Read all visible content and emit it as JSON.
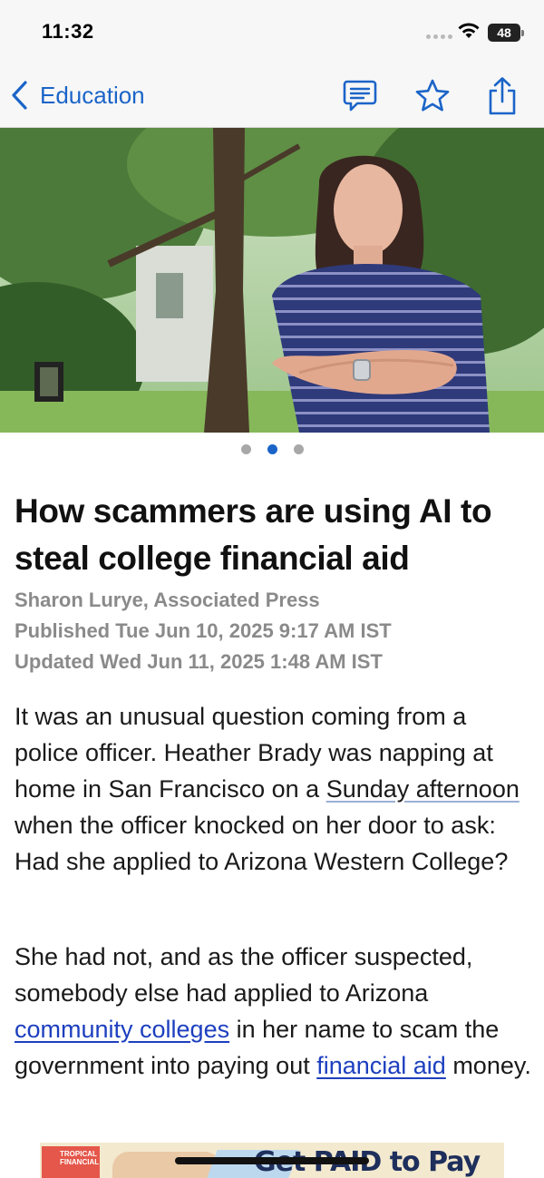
{
  "status_bar": {
    "time": "11:32",
    "battery": "48",
    "icons": [
      "signal-dots-icon",
      "wifi-icon",
      "battery-icon"
    ]
  },
  "nav": {
    "back_label": "Education",
    "icons": [
      "back-chevron-icon",
      "comments-icon",
      "star-icon",
      "share-icon"
    ],
    "accent_color": "#1b64c8"
  },
  "carousel": {
    "total": 3,
    "active_index": 2
  },
  "article": {
    "headline": "How scammers are using AI to steal college financial aid",
    "author": "Sharon Lurye, Associated Press",
    "published": "Published Tue Jun 10, 2025 9:17 AM IST",
    "updated": "Updated Wed Jun 11, 2025 1:48 AM IST",
    "p1": {
      "before": "It was an unusual question coming from a police officer. Heather Brady was napping at home in San Francisco on a ",
      "link": "Sunday afternoon",
      "after": " when the officer knocked on her door to ask: Had she applied to Ari­zona Western College?"
    },
    "p2": {
      "before": "She had not, and as the officer suspect­ed, somebody else had applied to Ari­zona ",
      "link1": "community colleges",
      "middle": " in her name to scam the government into paying out ",
      "link2": "fi­nancial aid",
      "after": " money."
    },
    "link_color": "#1d3fbf"
  },
  "ad": {
    "logo_text": "TROPICAL FINANCIAL",
    "text": "Get PAID to Pay"
  }
}
